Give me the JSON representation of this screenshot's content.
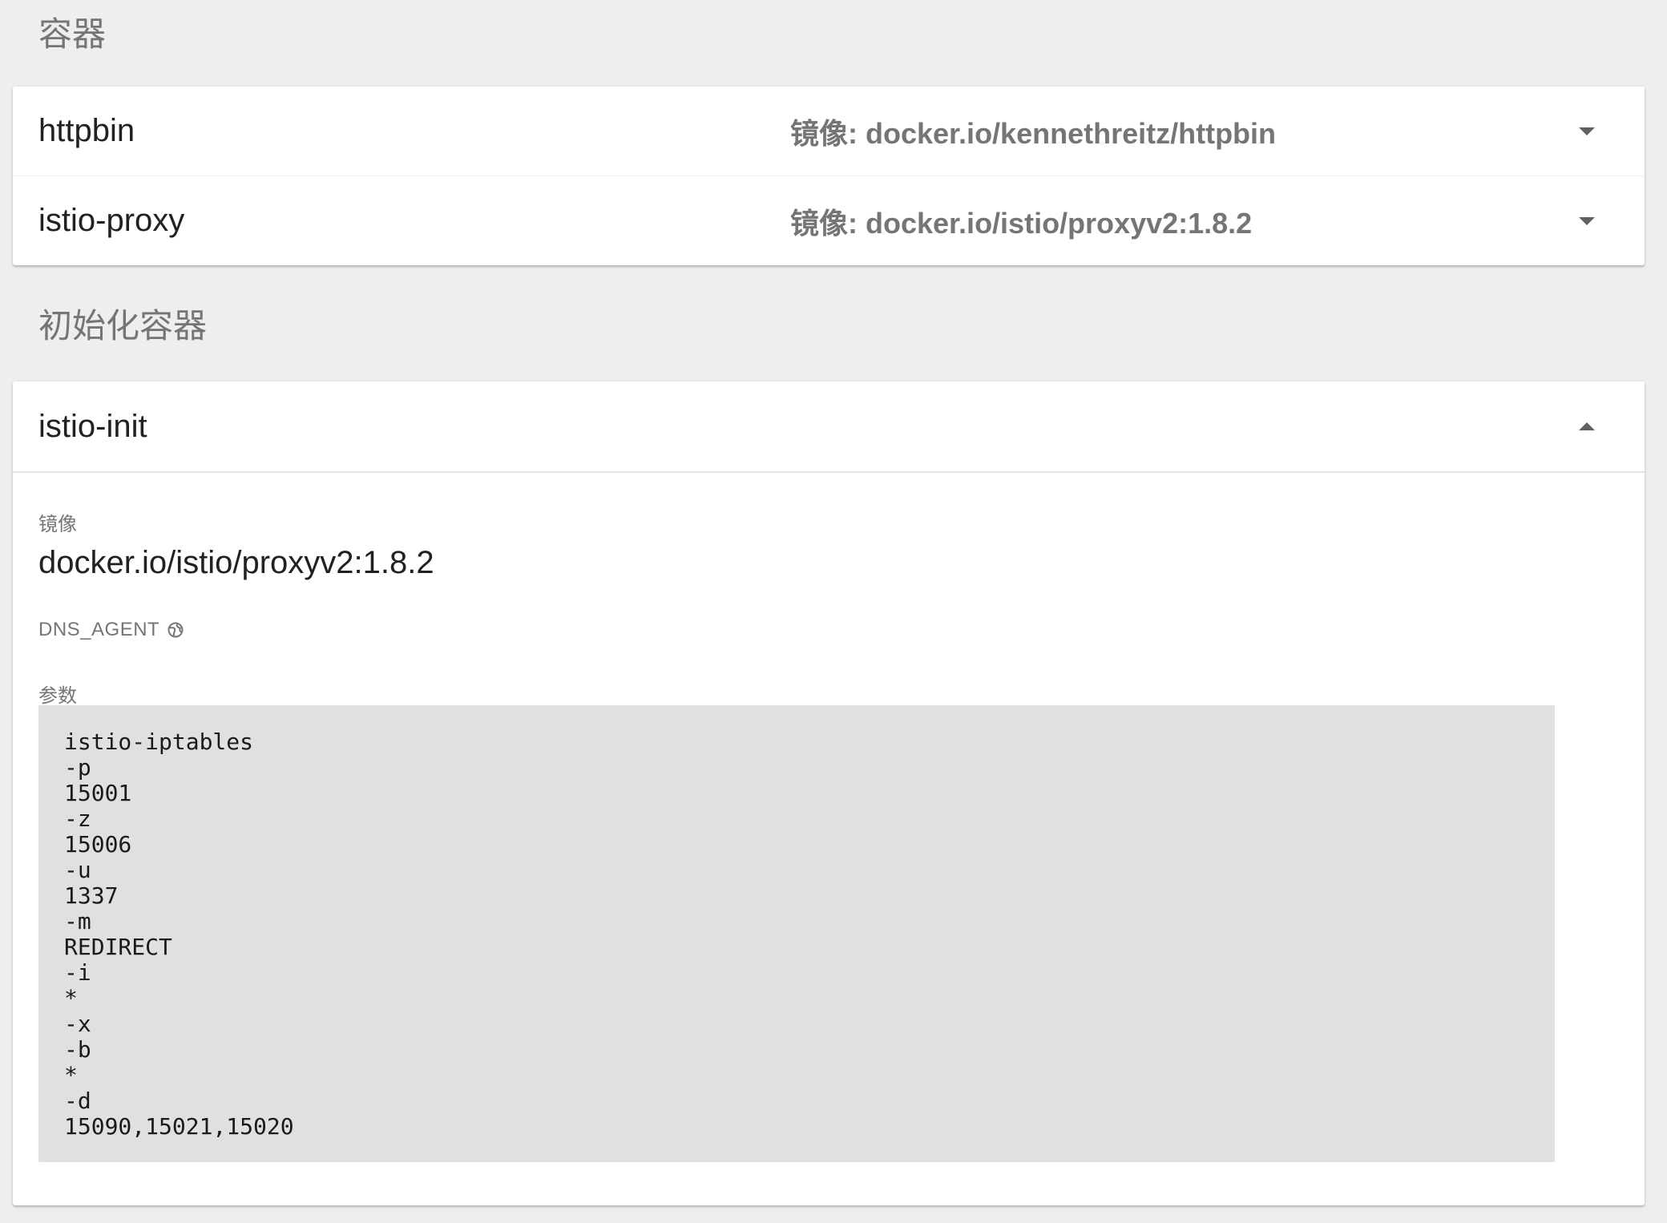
{
  "sections": {
    "containers_title": "容器",
    "init_containers_title": "初始化容器"
  },
  "containers": [
    {
      "name": "httpbin",
      "image_text": "镜像: docker.io/kennethreitz/httpbin"
    },
    {
      "name": "istio-proxy",
      "image_text": "镜像: docker.io/istio/proxyv2:1.8.2"
    }
  ],
  "init_container": {
    "name": "istio-init",
    "image_label": "镜像",
    "image_value": "docker.io/istio/proxyv2:1.8.2",
    "env_name": "DNS_AGENT",
    "args_label": "参数",
    "args": [
      "istio-iptables",
      "-p",
      "15001",
      "-z",
      "15006",
      "-u",
      "1337",
      "-m",
      "REDIRECT",
      "-i",
      "*",
      "-x",
      "-b",
      "*",
      "-d",
      "15090,15021,15020"
    ]
  },
  "icons": {
    "collapsed": "chevron-down-icon",
    "expanded": "chevron-up-icon",
    "env": "globe-icon"
  },
  "colors": {
    "background": "#edeef0",
    "card": "#ffffff",
    "muted_text": "#757575",
    "code_bg": "#e0e0e0"
  }
}
